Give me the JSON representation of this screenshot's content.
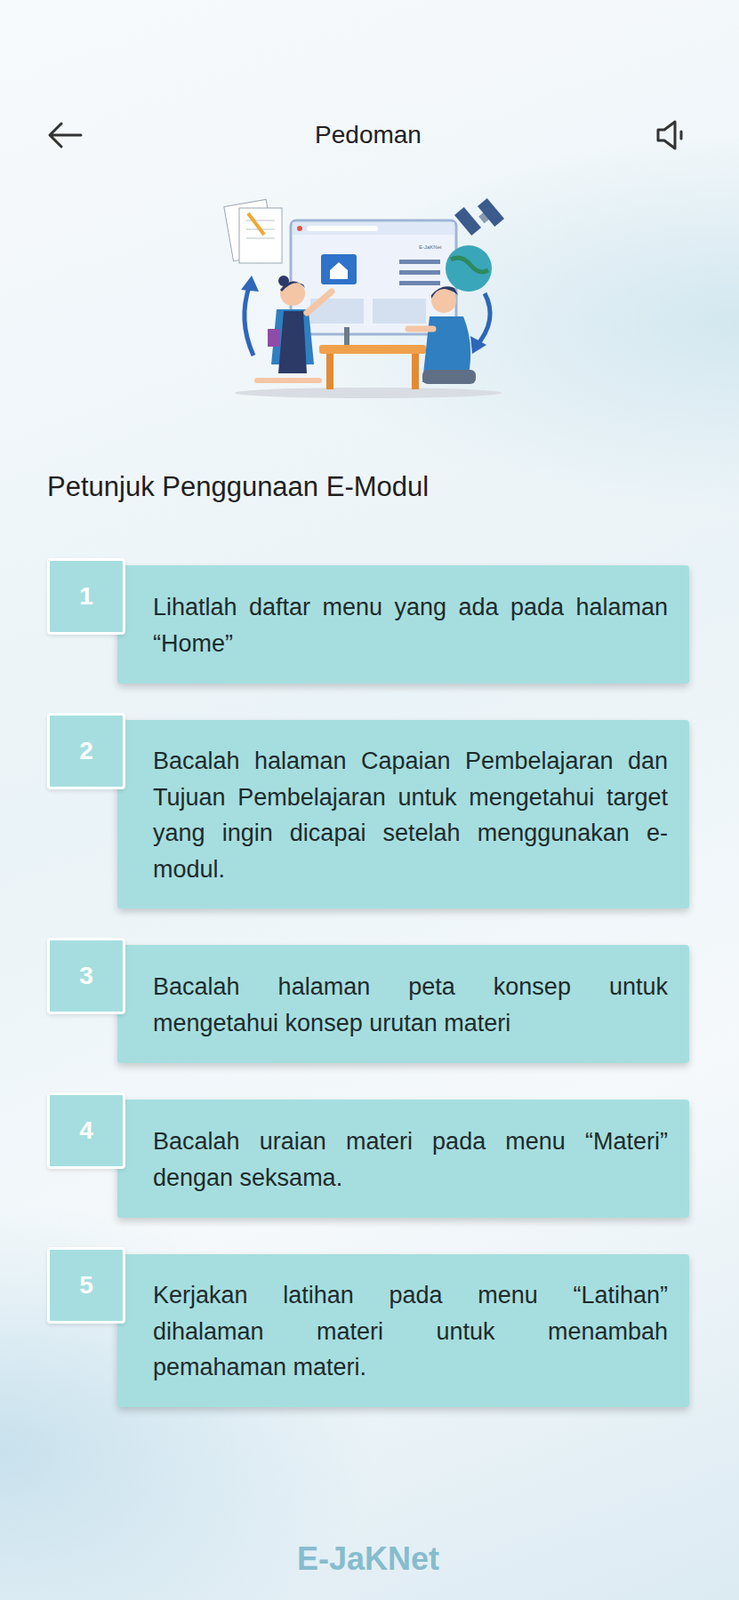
{
  "header": {
    "title": "Pedoman",
    "back_button": true,
    "sound_button": true
  },
  "illustration": {
    "screen_label": "E-JaKNet"
  },
  "heading": "Petunjuk Penggunaan E-Modul",
  "steps": [
    {
      "number": "1",
      "text": "Lihatlah daftar menu yang ada pada halaman “Home”"
    },
    {
      "number": "2",
      "text": "Bacalah halaman Capaian Pembelajaran dan Tujuan Pembelajaran untuk mengetahui target yang ingin dicapai setelah menggunakan e-modul."
    },
    {
      "number": "3",
      "text": "Bacalah halaman peta konsep untuk mengetahui konsep urutan materi"
    },
    {
      "number": "4",
      "text": "Bacalah uraian materi pada menu “Materi” dengan seksama."
    },
    {
      "number": "5",
      "text": "Kerjakan latihan pada menu “Latihan” dihalaman materi untuk menambah pemahaman materi."
    }
  ],
  "watermark": "E-JaKNet"
}
